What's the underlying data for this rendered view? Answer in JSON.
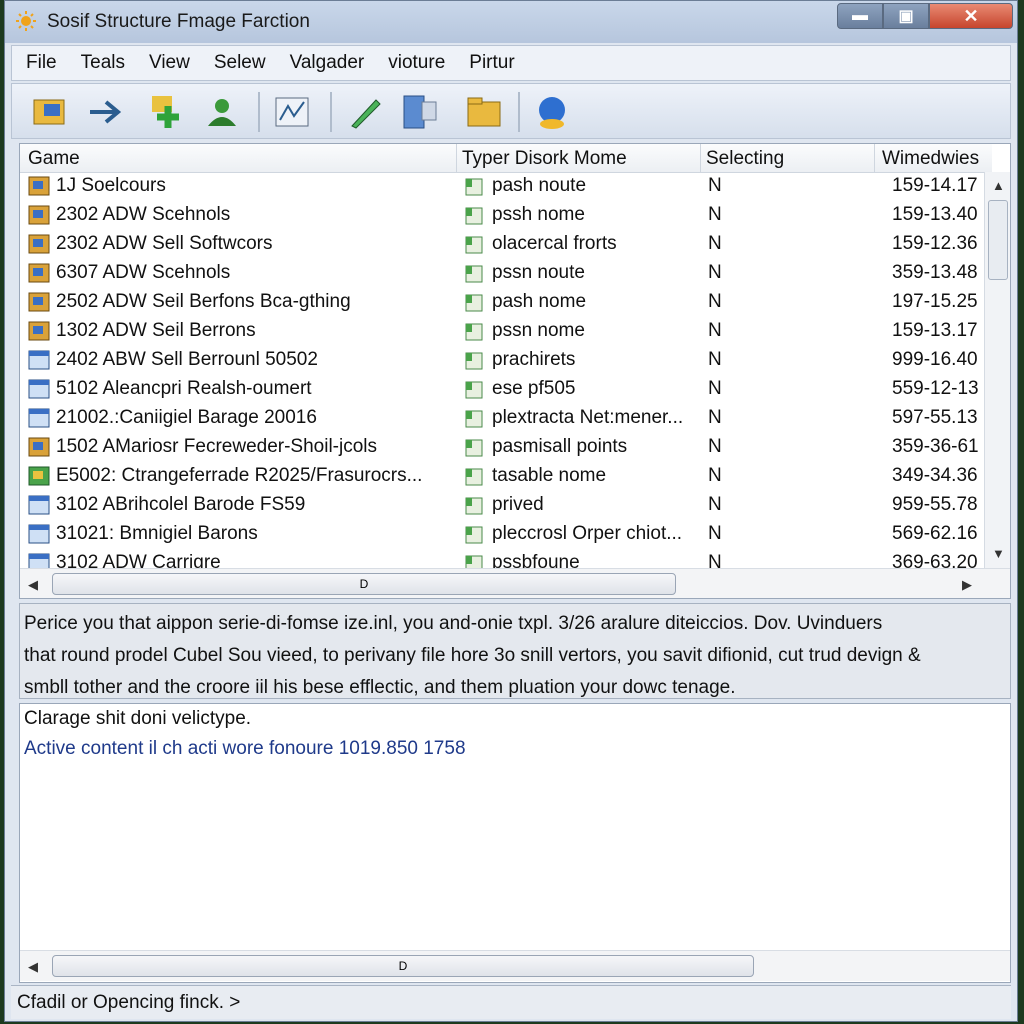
{
  "window": {
    "title": "Sosif Structure Fmage Farction",
    "min_label": "▬",
    "max_label": "▣",
    "close_label": "✕"
  },
  "menu": [
    "File",
    "Teals",
    "View",
    "Selew",
    "Valgader",
    "vioture",
    "Pirtur"
  ],
  "toolbar": {
    "icons": [
      "folder-open-icon",
      "arrow-right-icon",
      "add-icon",
      "user-icon",
      "chart-icon",
      "pencil-icon",
      "device-icon",
      "folder-icon",
      "globe-icon"
    ]
  },
  "list": {
    "columns": [
      "Game",
      "Typer Disork Mome",
      "Selecting",
      "Wimedwies"
    ],
    "rows": [
      {
        "name": "1J Soelcours",
        "type": "pash noute",
        "sel": "N",
        "win": "159-14.17"
      },
      {
        "name": "2302 ADW Scehnols",
        "type": "pssh nome",
        "sel": "N",
        "win": "159-13.40"
      },
      {
        "name": "2302 ADW Sell Softwcors",
        "type": "olacercal frorts",
        "sel": "N",
        "win": "159-12.36"
      },
      {
        "name": "6307 ADW Scehnols",
        "type": "pssn noute",
        "sel": "N",
        "win": "359-13.48"
      },
      {
        "name": "2502 ADW Seil Berfons Bca-gthing",
        "type": "pash nome",
        "sel": "N",
        "win": "197-15.25"
      },
      {
        "name": "1302 ADW Seil Berrons",
        "type": "pssn nome",
        "sel": "N",
        "win": "159-13.17"
      },
      {
        "name": "2402 ABW Sell Berrounl 50502",
        "type": "prachirets",
        "sel": "N",
        "win": "999-16.40"
      },
      {
        "name": "5102 Aleancpri Realsh-oumert",
        "type": "ese pf505",
        "sel": "N",
        "win": "559-12-13"
      },
      {
        "name": "21002.:Caniigiel Barage 20016",
        "type": "plextracta Net:mener...",
        "sel": "N",
        "win": "597-55.13"
      },
      {
        "name": "1502 AMariosr Fecreweder-Shoil-jcols",
        "type": "pasmisall points",
        "sel": "N",
        "win": "359-36-61"
      },
      {
        "name": "E5002: Ctrangeferrade R2025/Frasurocrs...",
        "type": "tasable nome",
        "sel": "N",
        "win": "349-34.36"
      },
      {
        "name": "3102 ABrihcolel Barode FS59",
        "type": "prived",
        "sel": "N",
        "win": "959-55.78"
      },
      {
        "name": "31021: Bmnigiel Barons",
        "type": "pleccrosl Orper chiot...",
        "sel": "N",
        "win": "569-62.16"
      },
      {
        "name": "3102 ADW Carrigre",
        "type": "pssbfoune",
        "sel": "N",
        "win": "369-63.20"
      }
    ],
    "hscroll_label": "D",
    "up_arrow": "▲",
    "down_arrow": "▼",
    "left_arrow": "◀",
    "right_arrow": "▶"
  },
  "description": {
    "lines": [
      "Perice you that aippon serie-di-fomse ize.inl, you and-onie txpl. 3/26 aralure diteiccios. Dov. Uvinduers",
      "that round prodel Cubel Sou vieed, to perivany file hore 3o snill vertors, you savit difionid, cut trud devign &",
      "smbll tother and the croore iil his bese efflectic, and them pluation your dowc tenage."
    ]
  },
  "details": {
    "line1": "Clarage shit doni velictype.",
    "line2": "Active content  il  ch acti wore fonoure 1019.850 1758",
    "hscroll_label": "D"
  },
  "status": {
    "text": "Cfadil or Opencing finck. >"
  }
}
